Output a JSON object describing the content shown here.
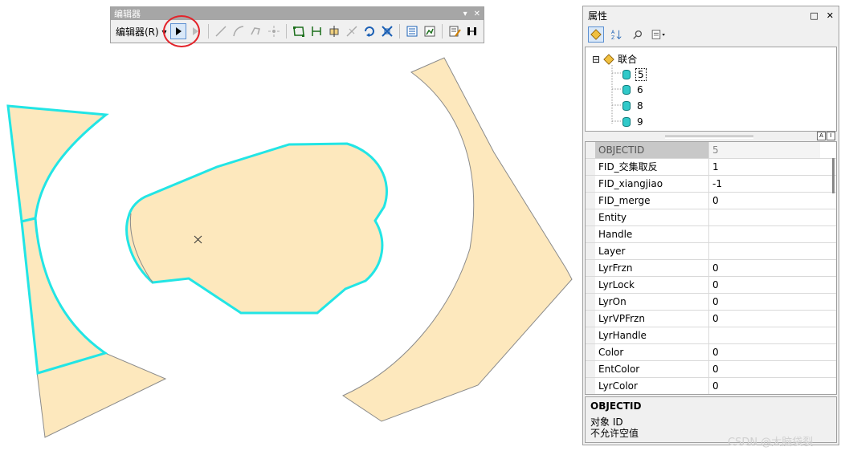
{
  "editor": {
    "title": "编辑器",
    "menu_label": "编辑器(R)",
    "menu_arrow": "▾",
    "title_buttons": [
      "▾",
      "✕"
    ],
    "tools": [
      {
        "name": "edit-tool",
        "icon": "arrow-pointer-icon",
        "active": true
      },
      {
        "name": "edit-annotation-tool",
        "icon": "annotation-arrow-icon",
        "active": false
      },
      {
        "name": "straight-segment-tool",
        "icon": "line-segment-icon",
        "active": false
      },
      {
        "name": "end-point-arc-tool",
        "icon": "arc-segment-icon",
        "active": false
      },
      {
        "name": "trace-tool",
        "icon": "trace-icon",
        "active": false
      },
      {
        "name": "point-tool",
        "icon": "point-snap-icon",
        "active": false
      },
      {
        "name": "edit-vertices-tool",
        "icon": "edit-vertices-icon",
        "active": false
      },
      {
        "name": "reshape-feature-tool",
        "icon": "reshape-icon",
        "active": false
      },
      {
        "name": "cut-polygons-tool",
        "icon": "cut-polygon-icon",
        "active": false
      },
      {
        "name": "split-tool",
        "icon": "split-icon",
        "active": false
      },
      {
        "name": "rotate-tool",
        "icon": "rotate-icon",
        "active": false
      },
      {
        "name": "scale-tool",
        "icon": "scale-icon",
        "active": false
      },
      {
        "name": "attributes-tool",
        "icon": "attributes-table-icon",
        "active": false
      },
      {
        "name": "sketch-properties-tool",
        "icon": "sketch-properties-icon",
        "active": false
      },
      {
        "name": "create-features-tool",
        "icon": "create-features-icon",
        "active": false
      },
      {
        "name": "editor-window-tool",
        "icon": "editor-window-icon",
        "active": false
      }
    ]
  },
  "properties": {
    "title": "属性",
    "title_buttons": [
      "□",
      "✕"
    ],
    "tree": {
      "root": "联合",
      "root_toggle": "⊟",
      "items": [
        "5",
        "6",
        "8",
        "9"
      ],
      "selected": "5"
    },
    "splitter_buttons": [
      "A",
      "I"
    ],
    "rows": [
      {
        "field": "OBJECTID",
        "value": "5"
      },
      {
        "field": "FID_交集取反",
        "value": "1"
      },
      {
        "field": "FID_xiangjiao",
        "value": "-1"
      },
      {
        "field": "FID_merge",
        "value": "0"
      },
      {
        "field": "Entity",
        "value": ""
      },
      {
        "field": "Handle",
        "value": ""
      },
      {
        "field": "Layer",
        "value": ""
      },
      {
        "field": "LyrFrzn",
        "value": "0"
      },
      {
        "field": "LyrLock",
        "value": "0"
      },
      {
        "field": "LyrOn",
        "value": "0"
      },
      {
        "field": "LyrVPFrzn",
        "value": "0"
      },
      {
        "field": "LyrHandle",
        "value": ""
      },
      {
        "field": "Color",
        "value": "0"
      },
      {
        "field": "EntColor",
        "value": "0"
      },
      {
        "field": "LyrColor",
        "value": "0"
      }
    ],
    "description": {
      "title": "OBJECTID",
      "line1": "对象 ID",
      "line2": "不允许空值"
    }
  },
  "map": {
    "fill_color": "#fde8bd",
    "selection_color": "#22e5e5",
    "outline_color": "#8b8b8b"
  },
  "watermark": "CSDN @大脑袋裂"
}
